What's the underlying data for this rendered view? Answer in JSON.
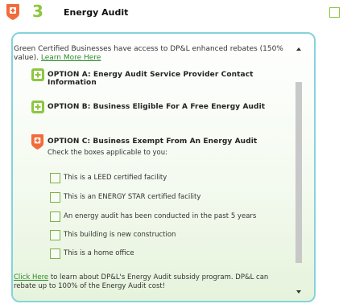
{
  "step": {
    "number": "3",
    "title": "Energy Audit",
    "colors": {
      "accent_green": "#8dc63f",
      "accent_orange": "#f26b3a",
      "panel_border": "#84d3dc"
    }
  },
  "intro": {
    "text": "Green Certified Businesses have access to DP&L enhanced rebates (150% value).",
    "link_label": "Learn More Here"
  },
  "options": [
    {
      "title": "OPTION A: Energy Audit Service Provider Contact Information",
      "icon": "plus-icon",
      "state": "collapsed"
    },
    {
      "title": "OPTION B: Business Eligible For A Free Energy Audit",
      "icon": "plus-icon",
      "state": "collapsed"
    },
    {
      "title": "OPTION C: Business Exempt From An Energy Audit",
      "icon": "minus-icon",
      "state": "expanded"
    }
  ],
  "option_c": {
    "instruction": "Check the boxes applicable to you:",
    "checkboxes": [
      "This is a LEED certified facility",
      "This is an ENERGY STAR certified facility",
      "An energy audit has been conducted in the past 5 years",
      "This building is new construction",
      "This is a home office"
    ]
  },
  "footer": {
    "link_label": "Click Here",
    "text": " to learn about DP&L's Energy Audit subsidy program. DP&L can rebate up to 100% of the Energy Audit cost!"
  }
}
